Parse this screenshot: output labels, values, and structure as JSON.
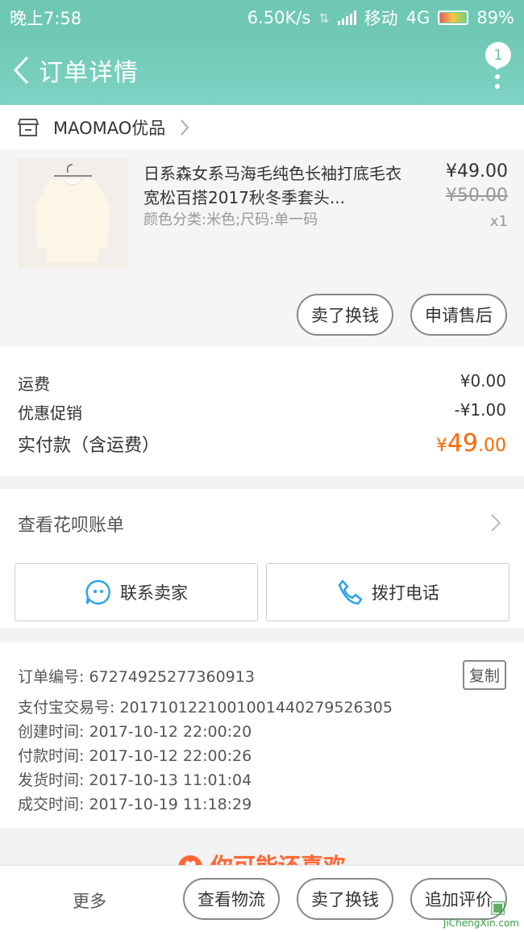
{
  "status_bar": {
    "time": "晚上7:58",
    "speed": "6.50K/s",
    "carrier": "移动",
    "network": "4G",
    "battery": "89%"
  },
  "app_bar": {
    "title": "订单详情",
    "badge_count": "1"
  },
  "shop": {
    "name": "MAOMAO优品"
  },
  "product": {
    "name": "日系森女系马海毛纯色长袖打底毛衣宽松百搭2017秋冬季套头...",
    "spec": "颜色分类:米色;尺码:单一码",
    "price": "¥49.00",
    "original_price": "¥50.00",
    "quantity": "x1",
    "actions": {
      "sell": "卖了换钱",
      "after_sale": "申请售后"
    }
  },
  "fees": {
    "shipping_label": "运费",
    "shipping_value": "¥0.00",
    "discount_label": "优惠促销",
    "discount_value": "-¥1.00",
    "total_label": "实付款（含运费）",
    "total_currency": "¥",
    "total_int": "49",
    "total_dec": ".00"
  },
  "huabei": {
    "label": "查看花呗账单"
  },
  "contact": {
    "seller_label": "联系卖家",
    "call_label": "拨打电话"
  },
  "order_info": {
    "order_no": "订单编号: 67274925277360913",
    "alipay_no": "支付宝交易号: 2017101221001001440279526305",
    "created": "创建时间: 2017-10-12 22:00:20",
    "paid": "付款时间: 2017-10-12 22:00:26",
    "shipped": "发货时间: 2017-10-13 11:01:04",
    "completed": "成交时间: 2017-10-19 11:18:29",
    "copy_label": "复制"
  },
  "recommend": {
    "title": "你可能还喜欢"
  },
  "bottom_bar": {
    "more": "更多",
    "logistics": "查看物流",
    "sell": "卖了换钱",
    "review": "追加评价"
  },
  "watermark": {
    "text": "JiChengXin.com"
  },
  "colors": {
    "accent": "#6fc8b3",
    "price_orange": "#ff6600",
    "chat_blue": "#2aa4e6"
  }
}
